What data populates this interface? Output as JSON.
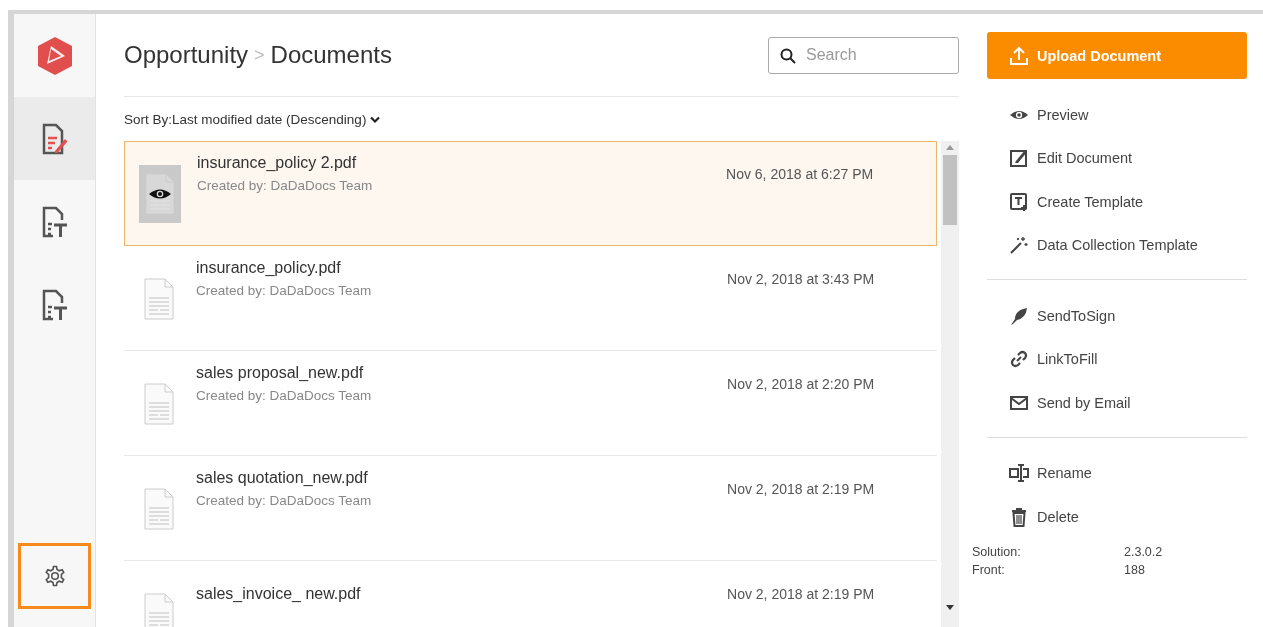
{
  "sidebar": {
    "items": [
      {
        "kind": "edit",
        "selected": true
      },
      {
        "kind": "template",
        "selected": false
      },
      {
        "kind": "template",
        "selected": false
      }
    ],
    "settings": {
      "highlighted": true
    }
  },
  "header": {
    "breadcrumb": [
      "Opportunity",
      "Documents"
    ],
    "separator": ">",
    "search": {
      "placeholder": "Search"
    }
  },
  "sort": {
    "label": "Sort By:Last modified date (Descending)"
  },
  "documents": [
    {
      "name": "insurance_policy 2.pdf",
      "created_by": "Created by: DaDaDocs Team",
      "modified": "Nov 6, 2018 at 6:27 PM",
      "selected": true
    },
    {
      "name": "insurance_policy.pdf",
      "created_by": "Created by: DaDaDocs Team",
      "modified": "Nov 2, 2018 at 3:43 PM",
      "selected": false
    },
    {
      "name": "sales proposal_new.pdf",
      "created_by": "Created by: DaDaDocs Team",
      "modified": "Nov 2, 2018 at 2:20 PM",
      "selected": false
    },
    {
      "name": "sales quotation_new.pdf",
      "created_by": "Created by: DaDaDocs Team",
      "modified": "Nov 2, 2018 at 2:19 PM",
      "selected": false
    },
    {
      "name": "sales_invoice_ new.pdf",
      "modified": "Nov 2, 2018 at 2:19 PM",
      "selected": false
    }
  ],
  "upload_button": "Upload Document",
  "action_groups": [
    [
      {
        "kind": "preview",
        "label": "Preview"
      },
      {
        "kind": "edit",
        "label": "Edit Document"
      },
      {
        "kind": "template",
        "label": "Create Template"
      },
      {
        "kind": "collect",
        "label": "Data Collection Template"
      }
    ],
    [
      {
        "kind": "sign",
        "label": "SendToSign"
      },
      {
        "kind": "fill",
        "label": "LinkToFill"
      },
      {
        "kind": "email",
        "label": "Send by Email"
      }
    ],
    [
      {
        "kind": "rename",
        "label": "Rename"
      },
      {
        "kind": "delete",
        "label": "Delete"
      }
    ]
  ],
  "version": [
    {
      "label": "Solution:",
      "value": "2.3.0.2"
    },
    {
      "label": "Front:",
      "value": "188"
    }
  ]
}
